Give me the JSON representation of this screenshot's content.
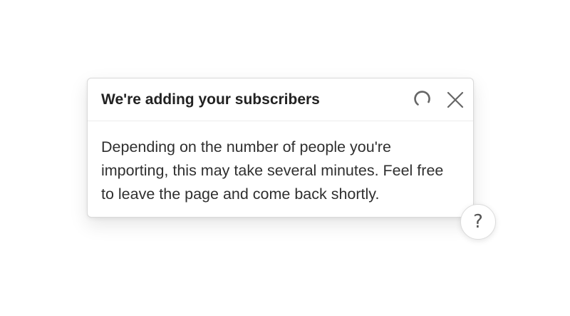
{
  "toast": {
    "title": "We're adding your subscribers",
    "status_icon": "loading-spinner-icon",
    "close_icon": "close-icon",
    "message_lines": [
      "Depending on the number of people you're",
      "importing, this may take several minutes. Feel free",
      "to leave the page and come back shortly."
    ]
  },
  "help": {
    "label": "?",
    "icon": "question-mark-icon"
  },
  "colors": {
    "background": "#ffffff",
    "border": "#d9d9d9",
    "text": "#2f2f2f",
    "icon": "#666666"
  }
}
